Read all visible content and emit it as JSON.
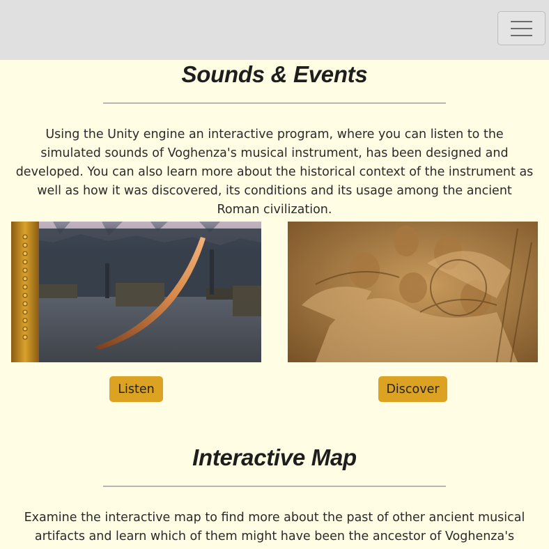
{
  "navbar": {
    "toggle_icon": "hamburger-icon"
  },
  "sounds": {
    "title": "Sounds & Events",
    "description": "Using the Unity engine an interactive program, where you can listen to the simulated sounds of Voghenza's musical instrument, has been designed and developed. You can also learn more about the historical context of the instrument as well as how it was discovered, its conditions and its usage among the ancient Roman civilization.",
    "cards": [
      {
        "image": "unity-scene-horn-image",
        "button": "Listen"
      },
      {
        "image": "roman-relief-image",
        "button": "Discover"
      }
    ]
  },
  "map": {
    "title": "Interactive Map",
    "description": "Examine the interactive map to find more about the past of other ancient musical artifacts and learn which of them might have been the ancestor of Voghenza's"
  },
  "colors": {
    "background": "#fffde3",
    "navbar": "#e0e0e0",
    "button": "#dba321"
  }
}
